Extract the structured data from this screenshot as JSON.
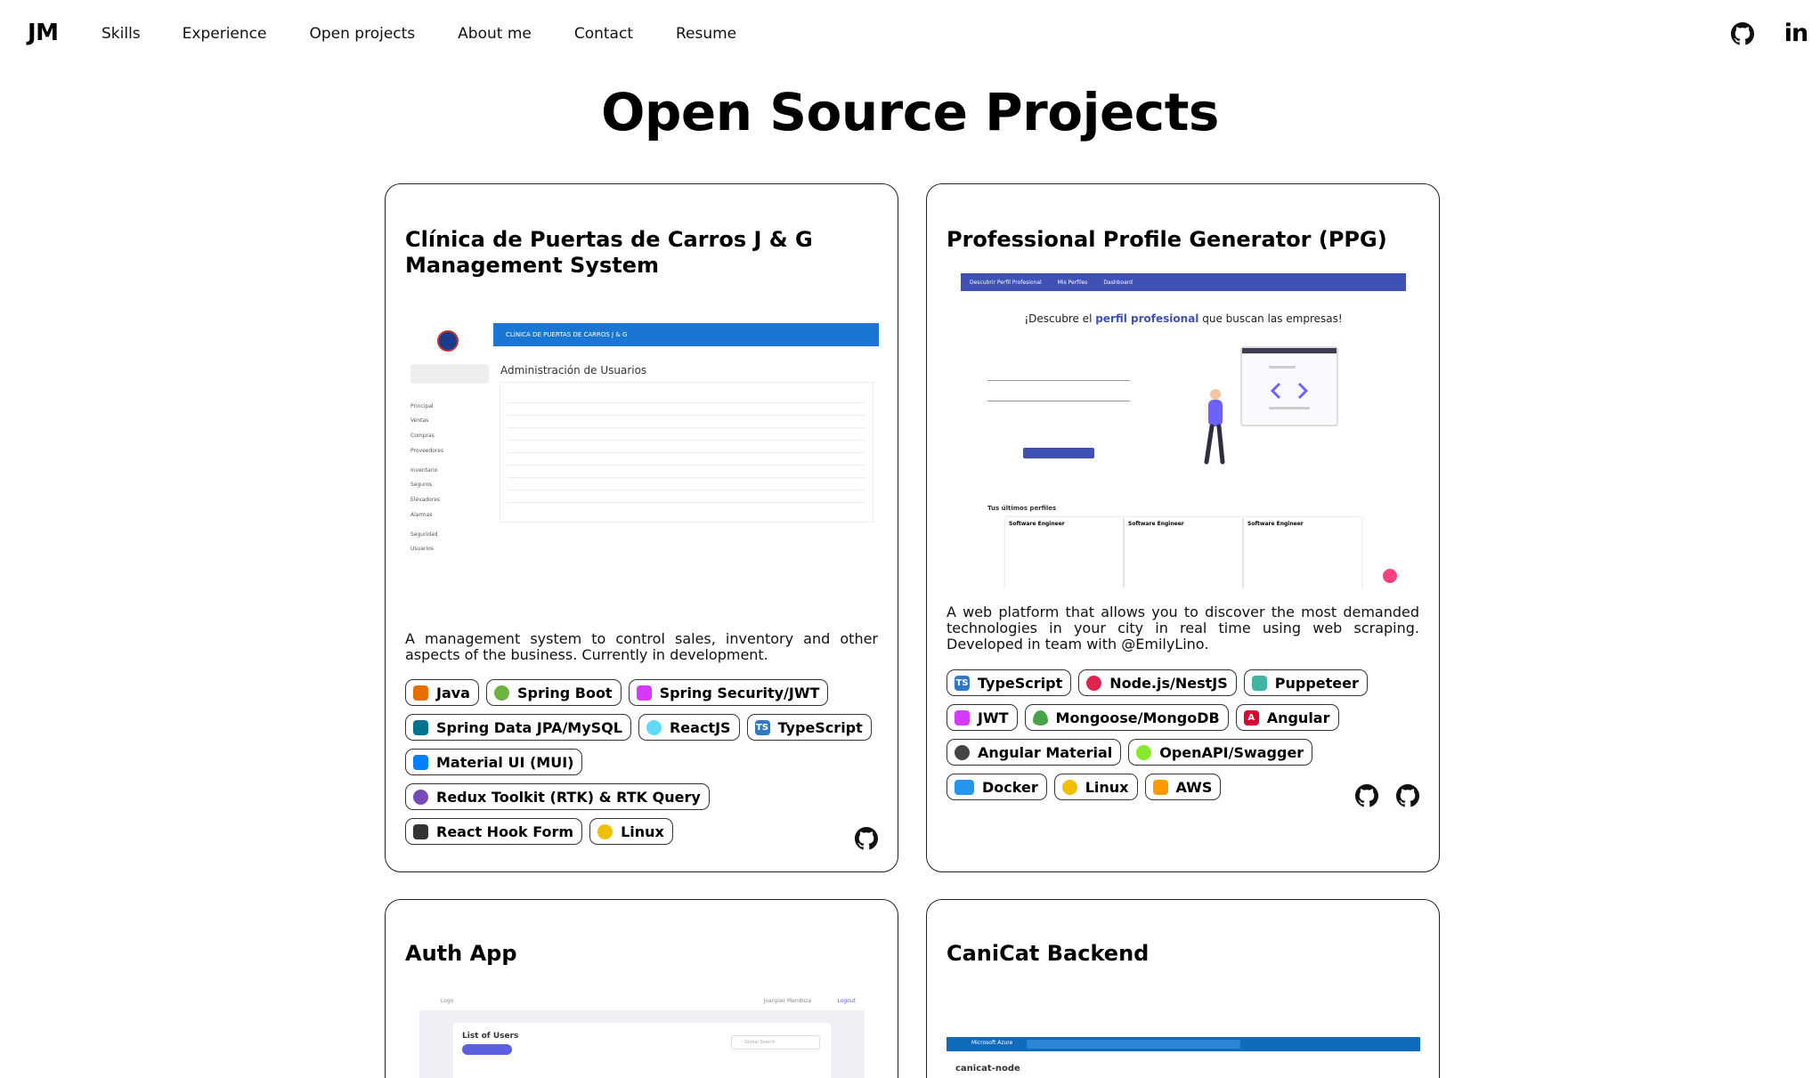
{
  "nav": {
    "brand": "JM",
    "links": [
      "Skills",
      "Experience",
      "Open projects",
      "About me",
      "Contact",
      "Resume"
    ],
    "icons": [
      "github-icon",
      "linkedin-icon"
    ],
    "linkedin_glyph": "in"
  },
  "page_title": "Open Source Projects",
  "projects": [
    {
      "title": "Clínica de Puertas de Carros J & G Management System",
      "description": "A management system to control sales, inventory and other aspects of the business. Currently in development.",
      "tags": [
        {
          "label": "Java",
          "icon": "java-icon",
          "color": "#e76f00"
        },
        {
          "label": "Spring Boot",
          "icon": "spring-icon",
          "color": "#6db33f"
        },
        {
          "label": "Spring Security/JWT",
          "icon": "jwt-icon",
          "color": "#d63aff"
        },
        {
          "label": "Spring Data JPA/MySQL",
          "icon": "mysql-icon",
          "color": "#00758f"
        },
        {
          "label": "ReactJS",
          "icon": "react-icon",
          "color": "#61dafb"
        },
        {
          "label": "TypeScript",
          "icon": "typescript-icon",
          "color": "#3178c6"
        },
        {
          "label": "Material UI (MUI)",
          "icon": "mui-icon",
          "color": "#007fff"
        },
        {
          "label": "Redux Toolkit (RTK) & RTK Query",
          "icon": "redux-icon",
          "color": "#764abc"
        },
        {
          "label": "React Hook Form",
          "icon": "wrench-icon",
          "color": "#333333"
        },
        {
          "label": "Linux",
          "icon": "linux-icon",
          "color": "#f0c000"
        }
      ],
      "links": [
        "github-icon"
      ],
      "screenshot": {
        "header": "CLÍNICA DE PUERTAS DE CARROS J & G",
        "title": "Administración de Usuarios",
        "menu": [
          "Principal",
          "Ventas",
          "Compras",
          "Proveedores",
          "Inventario",
          "Seguros",
          "Elevadores",
          "Alarmas",
          "Seguridad",
          "Usuarios"
        ]
      }
    },
    {
      "title": "Professional Profile Generator (PPG)",
      "description": "A web platform that allows you to discover the most demanded technologies in your city in real time using web scraping. Developed in team with @EmilyLino.",
      "tags": [
        {
          "label": "TypeScript",
          "icon": "typescript-icon",
          "color": "#3178c6"
        },
        {
          "label": "Node.js/NestJS",
          "icon": "nestjs-icon",
          "color": "#e0234e"
        },
        {
          "label": "Puppeteer",
          "icon": "puppeteer-icon",
          "color": "#40b5a4"
        },
        {
          "label": "JWT",
          "icon": "jwt-icon",
          "color": "#d63aff"
        },
        {
          "label": "Mongoose/MongoDB",
          "icon": "mongodb-icon",
          "color": "#47a248"
        },
        {
          "label": "Angular",
          "icon": "angular-icon",
          "color": "#dd0031"
        },
        {
          "label": "Angular Material",
          "icon": "angular-material-icon",
          "color": "#444444"
        },
        {
          "label": "OpenAPI/Swagger",
          "icon": "swagger-icon",
          "color": "#85ea2d"
        },
        {
          "label": "Docker",
          "icon": "docker-icon",
          "color": "#2496ed"
        },
        {
          "label": "Linux",
          "icon": "linux-icon",
          "color": "#f0c000"
        },
        {
          "label": "AWS",
          "icon": "aws-icon",
          "color": "#ff9900"
        }
      ],
      "links": [
        "github-icon",
        "github-icon"
      ],
      "screenshot": {
        "nav": [
          "Descubrir Perfil Profesional",
          "Mis Perfiles",
          "Dashboard"
        ],
        "headline_pre": "¡Descubre el ",
        "headline_em": "perfil profesional",
        "headline_post": " que buscan las empresas!",
        "recent": "Tus últimos perfiles",
        "profile_titles": [
          "Software Engineer",
          "Software Engineer",
          "Software Engineer"
        ]
      }
    },
    {
      "title": "Auth App",
      "screenshot": {
        "top_left": "Logo",
        "top_right": "Joanpier Mendoza",
        "logout": "Logout",
        "panel_title": "List of Users",
        "search_placeholder": "Global Search"
      }
    },
    {
      "title": "CaniCat Backend",
      "screenshot": {
        "brand": "Microsoft Azure",
        "resource": "canicat-node"
      }
    }
  ],
  "colors": {
    "accent_blue": "#1976d2",
    "ppg_indigo": "#3f51b5",
    "border": "#222222"
  }
}
